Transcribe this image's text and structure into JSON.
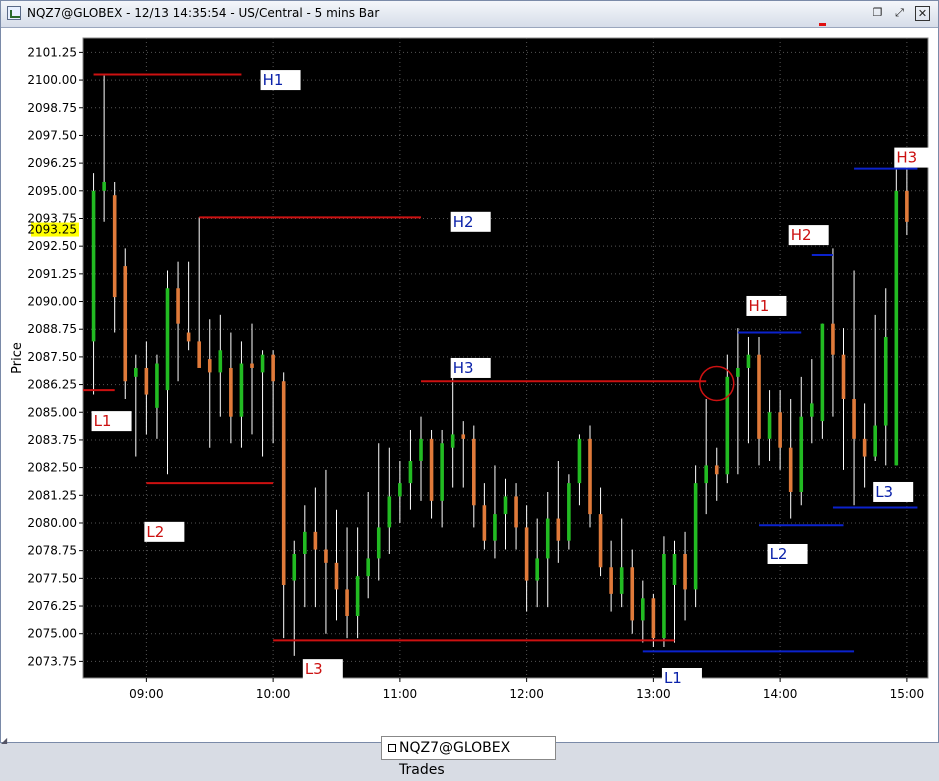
{
  "window": {
    "title": "NQZ7@GLOBEX - 12/13 14:35:54 - US/Central - 5 mins Bar",
    "buttons": [
      "restore",
      "maximize",
      "close"
    ]
  },
  "legend": {
    "label": "NQZ7@GLOBEX Trades"
  },
  "chart_data": {
    "type": "candlestick",
    "ylabel": "Price",
    "yticks": [
      "2101.25",
      "2100.00",
      "2098.75",
      "2097.50",
      "2096.25",
      "2095.00",
      "2093.75",
      "2092.50",
      "2091.25",
      "2090.00",
      "2088.75",
      "2087.50",
      "2086.25",
      "2085.00",
      "2083.75",
      "2082.50",
      "2081.25",
      "2080.00",
      "2078.75",
      "2077.50",
      "2076.25",
      "2075.00",
      "2073.75"
    ],
    "xticks": [
      "09:00",
      "10:00",
      "11:00",
      "12:00",
      "13:00",
      "14:00",
      "15:00"
    ],
    "ylim": [
      2073.0,
      2101.9
    ],
    "xlim": [
      "08:30",
      "15:10"
    ],
    "grid": true,
    "background": "#000000",
    "up_color": "#22bb22",
    "down_color": "#e07a3a",
    "wick_color": "#ffffff",
    "current_price": {
      "value": "2093.25",
      "highlight": "#ffff00"
    },
    "bars": [
      [
        "08:35",
        2088.2,
        2095.8,
        2085.8,
        2095.0
      ],
      [
        "08:40",
        2095.0,
        2100.2,
        2093.6,
        2095.4
      ],
      [
        "08:45",
        2094.8,
        2095.4,
        2088.6,
        2090.2
      ],
      [
        "08:50",
        2091.6,
        2092.4,
        2085.6,
        2086.4
      ],
      [
        "08:55",
        2086.6,
        2087.6,
        2083.0,
        2087.0
      ],
      [
        "09:00",
        2087.0,
        2088.2,
        2084.0,
        2085.8
      ],
      [
        "09:05",
        2085.2,
        2087.6,
        2083.8,
        2087.2
      ],
      [
        "09:10",
        2086.0,
        2091.4,
        2082.2,
        2090.6
      ],
      [
        "09:15",
        2090.6,
        2091.8,
        2086.4,
        2089.0
      ],
      [
        "09:20",
        2088.6,
        2091.8,
        2087.8,
        2088.2
      ],
      [
        "09:25",
        2088.2,
        2093.8,
        2087.2,
        2087.0
      ],
      [
        "09:30",
        2087.4,
        2089.2,
        2083.4,
        2086.8
      ],
      [
        "09:35",
        2086.8,
        2089.4,
        2084.8,
        2087.8
      ],
      [
        "09:40",
        2087.0,
        2088.6,
        2083.6,
        2084.8
      ],
      [
        "09:45",
        2084.8,
        2088.2,
        2083.4,
        2087.2
      ],
      [
        "09:50",
        2087.2,
        2089.0,
        2084.0,
        2087.0
      ],
      [
        "09:55",
        2086.8,
        2087.8,
        2083.0,
        2087.6
      ],
      [
        "10:00",
        2087.6,
        2087.8,
        2083.6,
        2086.4
      ],
      [
        "10:05",
        2086.4,
        2086.8,
        2074.8,
        2077.2
      ],
      [
        "10:10",
        2077.4,
        2079.2,
        2074.0,
        2078.6
      ],
      [
        "10:15",
        2078.6,
        2080.8,
        2076.2,
        2079.6
      ],
      [
        "10:20",
        2079.6,
        2081.6,
        2076.2,
        2078.8
      ],
      [
        "10:25",
        2078.8,
        2082.4,
        2075.0,
        2078.2
      ],
      [
        "10:30",
        2078.2,
        2080.6,
        2075.6,
        2077.0
      ],
      [
        "10:35",
        2077.0,
        2079.8,
        2074.8,
        2075.8
      ],
      [
        "10:40",
        2075.8,
        2079.8,
        2074.8,
        2077.6
      ],
      [
        "10:45",
        2077.6,
        2081.4,
        2076.6,
        2078.4
      ],
      [
        "10:50",
        2078.4,
        2083.6,
        2077.4,
        2079.8
      ],
      [
        "10:55",
        2079.8,
        2083.4,
        2078.6,
        2081.2
      ],
      [
        "11:00",
        2081.2,
        2082.8,
        2080.0,
        2081.8
      ],
      [
        "11:05",
        2081.8,
        2084.2,
        2080.6,
        2082.8
      ],
      [
        "11:10",
        2082.8,
        2084.8,
        2081.0,
        2083.8
      ],
      [
        "11:15",
        2083.8,
        2084.2,
        2080.2,
        2081.0
      ],
      [
        "11:20",
        2081.0,
        2084.2,
        2079.8,
        2083.6
      ],
      [
        "11:25",
        2083.4,
        2086.6,
        2081.6,
        2084.0
      ],
      [
        "11:30",
        2084.0,
        2084.6,
        2081.6,
        2083.8
      ],
      [
        "11:35",
        2083.8,
        2084.4,
        2079.8,
        2080.8
      ],
      [
        "11:40",
        2080.8,
        2081.8,
        2078.8,
        2079.2
      ],
      [
        "11:45",
        2079.2,
        2082.6,
        2078.4,
        2080.4
      ],
      [
        "11:50",
        2080.4,
        2082.0,
        2078.8,
        2081.2
      ],
      [
        "11:55",
        2081.2,
        2081.8,
        2078.8,
        2079.8
      ],
      [
        "12:00",
        2079.8,
        2080.8,
        2076.0,
        2077.4
      ],
      [
        "12:05",
        2077.4,
        2080.2,
        2076.2,
        2078.4
      ],
      [
        "12:10",
        2078.4,
        2081.4,
        2076.2,
        2080.2
      ],
      [
        "12:15",
        2080.2,
        2082.8,
        2078.2,
        2079.2
      ],
      [
        "12:20",
        2079.2,
        2082.2,
        2078.8,
        2081.8
      ],
      [
        "12:25",
        2081.8,
        2084.0,
        2080.8,
        2083.8
      ],
      [
        "12:30",
        2083.8,
        2084.4,
        2079.8,
        2080.4
      ],
      [
        "12:35",
        2080.4,
        2081.6,
        2077.6,
        2078.0
      ],
      [
        "12:40",
        2078.0,
        2079.2,
        2076.0,
        2076.8
      ],
      [
        "12:45",
        2076.8,
        2080.2,
        2076.2,
        2078.0
      ],
      [
        "12:50",
        2078.0,
        2078.8,
        2075.0,
        2075.6
      ],
      [
        "12:55",
        2075.6,
        2077.4,
        2074.6,
        2076.6
      ],
      [
        "13:00",
        2076.6,
        2076.8,
        2074.4,
        2074.8
      ],
      [
        "13:05",
        2074.8,
        2079.4,
        2074.4,
        2078.6
      ],
      [
        "13:10",
        2077.2,
        2079.2,
        2074.6,
        2078.6
      ],
      [
        "13:15",
        2078.6,
        2079.6,
        2075.6,
        2077.0
      ],
      [
        "13:20",
        2077.0,
        2082.6,
        2076.2,
        2081.8
      ],
      [
        "13:25",
        2081.8,
        2085.6,
        2080.4,
        2082.6
      ],
      [
        "13:30",
        2082.6,
        2083.4,
        2081.0,
        2082.2
      ],
      [
        "13:35",
        2082.2,
        2087.6,
        2081.8,
        2086.6
      ],
      [
        "13:40",
        2086.6,
        2088.8,
        2082.2,
        2087.0
      ],
      [
        "13:45",
        2087.0,
        2088.4,
        2083.6,
        2087.6
      ],
      [
        "13:50",
        2087.6,
        2088.4,
        2082.6,
        2083.8
      ],
      [
        "13:55",
        2083.8,
        2086.0,
        2082.8,
        2085.0
      ],
      [
        "14:00",
        2085.0,
        2086.0,
        2082.4,
        2083.4
      ],
      [
        "14:05",
        2083.4,
        2085.6,
        2080.2,
        2081.4
      ],
      [
        "14:10",
        2081.4,
        2086.6,
        2080.8,
        2084.8
      ],
      [
        "14:15",
        2084.8,
        2087.4,
        2083.6,
        2085.4
      ],
      [
        "14:20",
        2084.6,
        2089.0,
        2083.8,
        2089.0
      ],
      [
        "14:25",
        2089.0,
        2092.4,
        2084.8,
        2087.6
      ],
      [
        "14:30",
        2087.6,
        2088.8,
        2082.4,
        2085.6
      ],
      [
        "14:35",
        2085.6,
        2091.4,
        2080.8,
        2083.8
      ],
      [
        "14:40",
        2083.8,
        2085.4,
        2081.6,
        2083.0
      ],
      [
        "14:45",
        2083.0,
        2089.4,
        2082.8,
        2084.4
      ],
      [
        "14:50",
        2084.4,
        2090.6,
        2082.6,
        2088.4
      ],
      [
        "14:55",
        2082.6,
        2096.0,
        2082.6,
        2095.0
      ],
      [
        "15:00",
        2095.0,
        2096.4,
        2093.0,
        2093.6
      ]
    ],
    "levels": [
      {
        "label": "H1",
        "color": "#cc1111",
        "t0": "08:35",
        "t1": "09:45",
        "price": 2100.25,
        "label_color": "#0b22aa",
        "label_at": "09:55",
        "label_price": 2100.0
      },
      {
        "label": "H2",
        "color": "#cc1111",
        "t0": "09:25",
        "t1": "11:10",
        "price": 2093.8,
        "label_color": "#0b22aa",
        "label_at": "11:25",
        "label_price": 2093.6
      },
      {
        "label": "H3",
        "color": "#cc1111",
        "t0": "11:10",
        "t1": "13:25",
        "price": 2086.4,
        "label_color": "#0b22aa",
        "label_at": "11:25",
        "label_price": 2087.0
      },
      {
        "label": "L1",
        "color": "#cc1111",
        "t0": "08:30",
        "t1": "08:45",
        "price": 2086.0,
        "label_color": "#cc1111",
        "label_at": "08:35",
        "label_price": 2084.6
      },
      {
        "label": "L2",
        "color": "#cc1111",
        "t0": "09:00",
        "t1": "10:00",
        "price": 2081.8,
        "label_color": "#cc1111",
        "label_at": "09:00",
        "label_price": 2079.6
      },
      {
        "label": "L3",
        "color": "#cc1111",
        "t0": "10:00",
        "t1": "13:10",
        "price": 2074.7,
        "label_color": "#cc1111",
        "label_at": "10:15",
        "label_price": 2073.4
      },
      {
        "label": "H1",
        "color": "#0b22cc",
        "t0": "13:40",
        "t1": "14:10",
        "price": 2088.6,
        "label_color": "#cc1111",
        "label_at": "13:45",
        "label_price": 2089.8
      },
      {
        "label": "H2",
        "color": "#0b22cc",
        "t0": "14:15",
        "t1": "14:25",
        "price": 2092.1,
        "label_color": "#cc1111",
        "label_at": "14:05",
        "label_price": 2093.0
      },
      {
        "label": "H3",
        "color": "#0b22cc",
        "t0": "14:35",
        "t1": "15:05",
        "price": 2096.0,
        "label_color": "#cc1111",
        "label_at": "14:55",
        "label_price": 2096.5
      },
      {
        "label": "L1",
        "color": "#0b22cc",
        "t0": "12:55",
        "t1": "14:35",
        "price": 2074.2,
        "label_color": "#0b22aa",
        "label_at": "13:05",
        "label_price": 2073.0
      },
      {
        "label": "L2",
        "color": "#0b22cc",
        "t0": "13:50",
        "t1": "14:30",
        "price": 2079.9,
        "label_color": "#0b22aa",
        "label_at": "13:55",
        "label_price": 2078.6
      },
      {
        "label": "L3",
        "color": "#0b22cc",
        "t0": "14:25",
        "t1": "15:05",
        "price": 2080.7,
        "label_color": "#0b22aa",
        "label_at": "14:45",
        "label_price": 2081.4
      }
    ],
    "annotations": [
      {
        "type": "circle",
        "t": "13:30",
        "price": 2086.3,
        "color": "#cc1111"
      }
    ]
  }
}
